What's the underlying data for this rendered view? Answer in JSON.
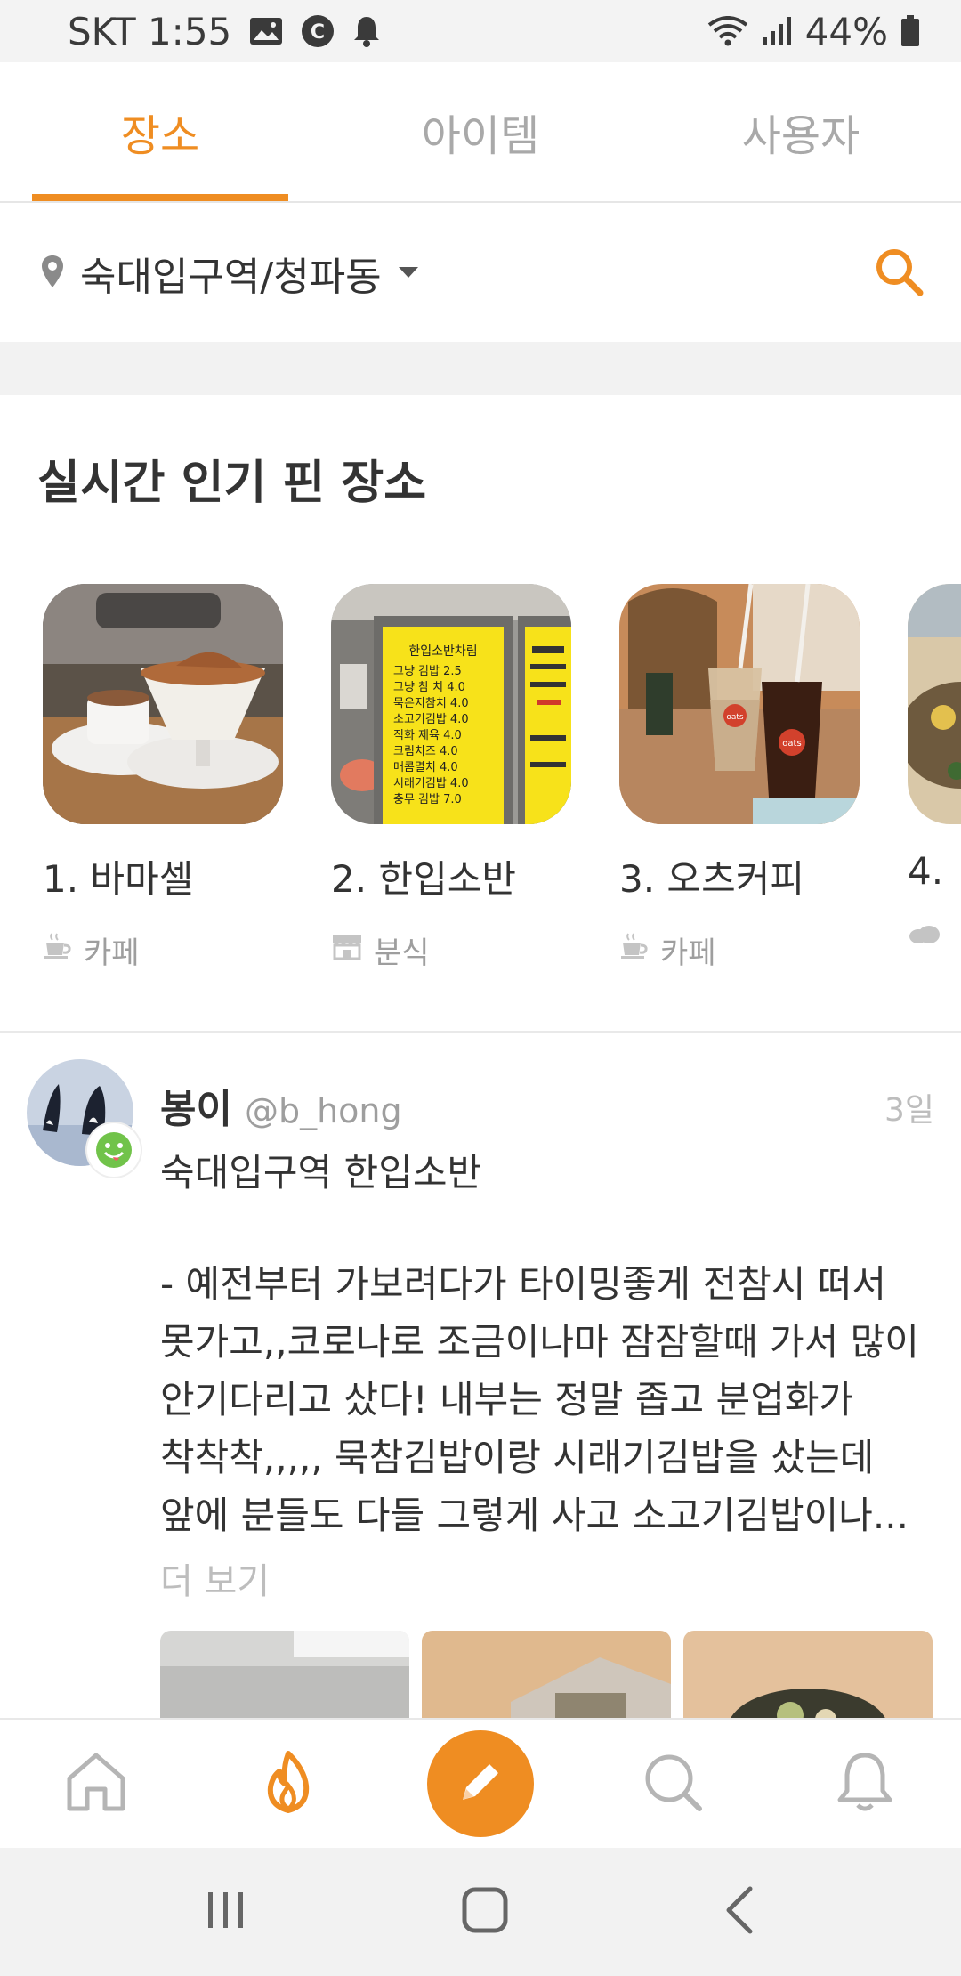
{
  "status_bar": {
    "carrier_time": "SKT 1:55",
    "battery": "44%"
  },
  "tabs": [
    {
      "label": "장소",
      "active": true
    },
    {
      "label": "아이템",
      "active": false
    },
    {
      "label": "사용자",
      "active": false
    }
  ],
  "location": {
    "label": "숙대입구역/청파동"
  },
  "section": {
    "title": "실시간 인기 핀 장소"
  },
  "places": [
    {
      "name": "1. 바마셀",
      "category": "카페",
      "icon": "coffee-icon"
    },
    {
      "name": "2. 한입소반",
      "category": "분식",
      "icon": "store-icon"
    },
    {
      "name": "3. 오츠커피",
      "category": "카페",
      "icon": "coffee-icon"
    },
    {
      "name": "4. ",
      "category": "",
      "icon": "cloud-icon"
    }
  ],
  "menu_board": {
    "title": "한입소반차림",
    "items": [
      "그냥 김밥 2.5",
      "그냥 참 치 4.0",
      "묵은지참치 4.0",
      "소고기김밥 4.0",
      "직화 제육 4.0",
      "크림치즈 4.0",
      "매콤멸치 4.0",
      "시래기김밥 4.0",
      "충무 김밥 7.0"
    ]
  },
  "cup_label": "oats",
  "post": {
    "author": "봉이",
    "handle": "@b_hong",
    "time": "3일",
    "place": "숙대입구역 한입소반",
    "lines": [
      "- 예전부터 가보려다가 타이밍좋게 전참시 떠서",
      "못가고,,코로나로 조금이나마 잠잠할때 가서 많이",
      "안기다리고 샀다! 내부는 정말 좁고 분업화가",
      "착착착,,,,, 묵참김밥이랑 시래기김밥을 샀는데",
      "앞에 분들도 다들 그렇게 사고 소고기김밥이나..."
    ],
    "more": "더 보기"
  },
  "colors": {
    "accent": "#ef8d22",
    "muted": "#a9a9a9"
  }
}
